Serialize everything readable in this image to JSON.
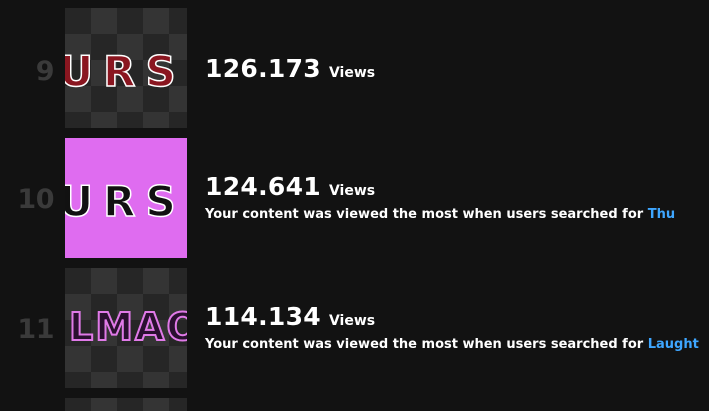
{
  "rows": [
    {
      "rank": "9",
      "views": "126.173",
      "views_label": "Views",
      "thumbnail_text": "URSD"
    },
    {
      "rank": "10",
      "views": "124.641",
      "views_label": "Views",
      "description": "Your content was viewed the most when users searched for",
      "search_term": "Thu",
      "thumbnail_text": "URSD"
    },
    {
      "rank": "11",
      "views": "114.134",
      "views_label": "Views",
      "description": "Your content was viewed the most when users searched for",
      "search_term": "Laught",
      "thumbnail_text": "LMAO"
    }
  ],
  "colors": {
    "background": "#121212",
    "rank_text": "#3a3a3a",
    "search_term_link": "#3ea6ff",
    "thumbnail_pink": "#df6cf0",
    "thumbnail_red_text": "#8a1620"
  }
}
